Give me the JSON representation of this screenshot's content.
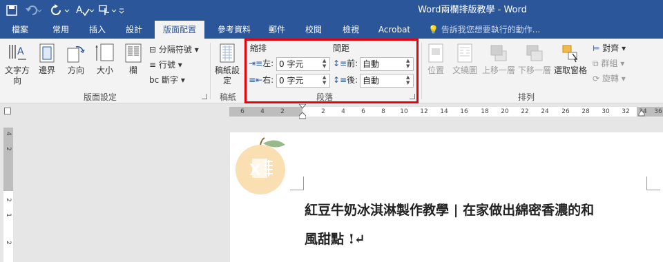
{
  "window": {
    "title": "Word兩欄排版教學 - Word"
  },
  "quick_access": {
    "undo_icon": "undo-icon",
    "redo_icon": "redo-icon",
    "repeat_icon": "repeat-icon",
    "spellcheck_icon": "spellcheck-icon",
    "touch_icon": "touch-mode-icon",
    "customize_icon": "customize-icon"
  },
  "tabs": [
    "檔案",
    "常用",
    "插入",
    "設計",
    "版面配置",
    "參考資料",
    "郵件",
    "校閱",
    "檢視",
    "Acrobat"
  ],
  "active_tab": "版面配置",
  "tell_me": "告訴我您想要執行的動作...",
  "ribbon": {
    "page_setup": {
      "label": "版面設定",
      "text_direction": "文字方向",
      "margins": "邊界",
      "orientation": "方向",
      "size": "大小",
      "columns": "欄",
      "breaks": "分隔符號",
      "line_numbers": "行號",
      "hyphenation": "斷字"
    },
    "manuscript": {
      "label": "稿紙",
      "settings": "稿紙設定"
    },
    "paragraph": {
      "label": "段落",
      "indent_header": "縮排",
      "spacing_header": "間距",
      "left_label": "左:",
      "right_label": "右:",
      "before_label": "前:",
      "after_label": "後:",
      "left_value": "0 字元",
      "right_value": "0 字元",
      "before_value": "自動",
      "after_value": "自動"
    },
    "arrange": {
      "label": "排列",
      "position": "位置",
      "wrap_text": "文繞圖",
      "bring_forward": "上移一層",
      "send_backward": "下移一層",
      "selection_pane": "選取窗格",
      "align": "對齊",
      "group": "群組",
      "rotate": "旋轉"
    }
  },
  "ruler": {
    "horizontal_ticks": [
      "6",
      "4",
      "2",
      "2",
      "4",
      "6",
      "8",
      "10",
      "12",
      "14",
      "16",
      "18",
      "20",
      "22",
      "24",
      "26",
      "28",
      "30",
      "32",
      "34",
      "36"
    ],
    "vertical_ticks": [
      "4",
      "2",
      "2",
      "1",
      "2"
    ]
  },
  "document": {
    "line1": "紅豆牛奶冰淇淋製作教學 | 在家做出綿密香濃的和",
    "line2": "風甜點 !↵"
  },
  "colors": {
    "accent": "#2b579a",
    "highlight": "#e8000b",
    "logo_orange": "#f6c572",
    "logo_leaf": "#7ea86b"
  }
}
